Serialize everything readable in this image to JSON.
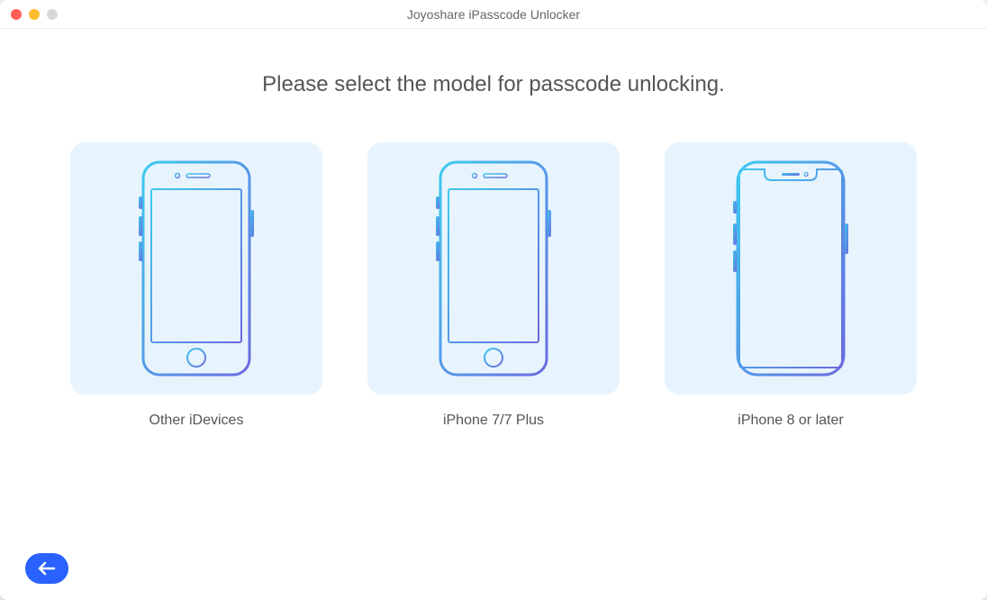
{
  "window": {
    "title": "Joyoshare iPasscode Unlocker"
  },
  "main": {
    "heading": "Please select the model for passcode unlocking.",
    "options": [
      {
        "label": "Other iDevices",
        "icon": "phone-home-button-icon"
      },
      {
        "label": "iPhone 7/7 Plus",
        "icon": "phone-home-button-icon"
      },
      {
        "label": "iPhone 8 or later",
        "icon": "phone-notch-icon"
      }
    ]
  },
  "nav": {
    "back_icon": "arrow-left"
  }
}
